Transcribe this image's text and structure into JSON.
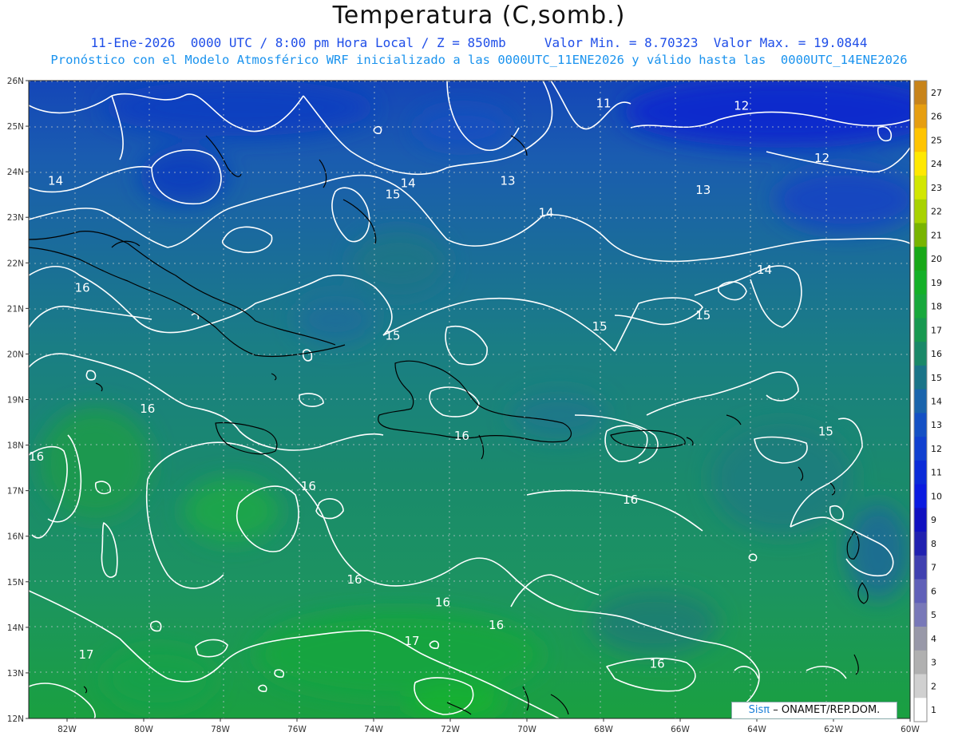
{
  "header": {
    "title": "Temperatura (C,somb.)",
    "subtitle_line1": "11-Ene-2026  0000 UTC / 8:00 pm Hora Local / Z = 850mb     Valor Min. = 8.70323  Valor Max. = 19.0844",
    "subtitle_line2": "Pronóstico con el Modelo Atmosférico WRF inicializado a las 0000UTC_11ENE2026 y válido hasta las  0000UTC_14ENE2026"
  },
  "map": {
    "lon_range": [
      -83,
      -60
    ],
    "lat_range": [
      12,
      26
    ],
    "lat_ticks": [
      "26N",
      "25N",
      "24N",
      "23N",
      "22N",
      "21N",
      "20N",
      "19N",
      "18N",
      "17N",
      "16N",
      "15N",
      "14N",
      "13N",
      "12N"
    ],
    "lon_ticks": [
      "82W",
      "80W",
      "78W",
      "76W",
      "74W",
      "72W",
      "70W",
      "68W",
      "66W",
      "64W",
      "62W",
      "60W"
    ],
    "contour_labels": [
      {
        "text": "12",
        "lon": -64.4,
        "lat": 25.45
      },
      {
        "text": "11",
        "lon": -68.0,
        "lat": 25.5
      },
      {
        "text": "12",
        "lon": -62.3,
        "lat": 24.3
      },
      {
        "text": "13",
        "lon": -70.5,
        "lat": 23.8
      },
      {
        "text": "13",
        "lon": -65.4,
        "lat": 23.6
      },
      {
        "text": "14",
        "lon": -82.3,
        "lat": 23.8
      },
      {
        "text": "14",
        "lon": -73.1,
        "lat": 23.75
      },
      {
        "text": "15",
        "lon": -73.5,
        "lat": 23.5
      },
      {
        "text": "14",
        "lon": -69.5,
        "lat": 23.1
      },
      {
        "text": "14",
        "lon": -63.8,
        "lat": 21.85
      },
      {
        "text": "16",
        "lon": -81.6,
        "lat": 21.45
      },
      {
        "text": "15",
        "lon": -65.4,
        "lat": 20.85
      },
      {
        "text": "15",
        "lon": -68.1,
        "lat": 20.6
      },
      {
        "text": "15",
        "lon": -73.5,
        "lat": 20.4
      },
      {
        "text": "16",
        "lon": -79.9,
        "lat": 18.8
      },
      {
        "text": "16",
        "lon": -71.7,
        "lat": 18.2
      },
      {
        "text": "15",
        "lon": -62.2,
        "lat": 18.3
      },
      {
        "text": "16",
        "lon": -82.8,
        "lat": 17.75
      },
      {
        "text": "16",
        "lon": -75.7,
        "lat": 17.1
      },
      {
        "text": "16",
        "lon": -67.3,
        "lat": 16.8
      },
      {
        "text": "16",
        "lon": -74.5,
        "lat": 15.05
      },
      {
        "text": "16",
        "lon": -72.2,
        "lat": 14.55
      },
      {
        "text": "16",
        "lon": -70.8,
        "lat": 14.05
      },
      {
        "text": "17",
        "lon": -73.0,
        "lat": 13.7
      },
      {
        "text": "17",
        "lon": -81.5,
        "lat": 13.4
      },
      {
        "text": "16",
        "lon": -66.6,
        "lat": 13.2
      }
    ]
  },
  "colorbar": {
    "labels": [
      "27",
      "26",
      "25",
      "24",
      "23",
      "22",
      "21",
      "20",
      "19",
      "18",
      "17",
      "16",
      "15",
      "14",
      "13",
      "12",
      "11",
      "10",
      "9",
      "8",
      "7",
      "6",
      "5",
      "4",
      "3",
      "2",
      "1"
    ],
    "colors": [
      "#c8841a",
      "#e69e10",
      "#ffc400",
      "#ffe800",
      "#d2e600",
      "#a8d200",
      "#78b400",
      "#18a818",
      "#14b028",
      "#18a83c",
      "#189850",
      "#1a8868",
      "#1a7488",
      "#1a64ac",
      "#1450c4",
      "#1040d0",
      "#0a2ad8",
      "#0a1ae0",
      "#1010c0",
      "#2020b0",
      "#4040b0",
      "#6060b8",
      "#7878b8",
      "#9898a8",
      "#b0b0b0",
      "#d0d0d0",
      "#ffffff"
    ]
  },
  "credit": {
    "sis": "Sisπ",
    "org": "– ONAMET/REP.DOM."
  }
}
